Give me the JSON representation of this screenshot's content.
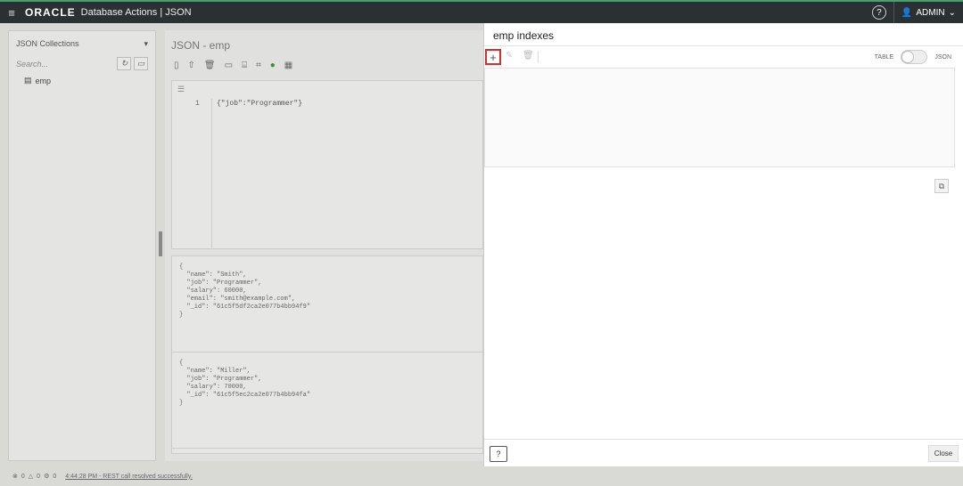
{
  "topbar": {
    "menu_icon": "hamburger-icon",
    "logo": "ORACLE",
    "app_title": "Database Actions | JSON",
    "help_icon": "?",
    "user_label": "ADMIN",
    "accent_color": "#3ea86b"
  },
  "left": {
    "header": "JSON Collections",
    "search_placeholder": "Search...",
    "items": [
      {
        "label": "emp"
      }
    ]
  },
  "center": {
    "title": "JSON - emp",
    "editor": {
      "line_number": "1",
      "code": "{\"job\":\"Programmer\"}"
    },
    "documents": [
      "{\n  \"name\": \"Smith\",\n  \"job\": \"Programmer\",\n  \"salary\": 60000,\n  \"email\": \"smith@example.com\",\n  \"_id\": \"61c5f5df2ca2e077b4bb94f9\"\n}",
      "{\n  \"name\": \"Miller\",\n  \"job\": \"Programmer\",\n  \"salary\": 70000,\n  \"_id\": \"61c5f5ec2ca2e077b4bb94fa\"\n}"
    ]
  },
  "drawer": {
    "title": "emp indexes",
    "add_label": "+",
    "toggle_left": "TABLE",
    "toggle_right": "JSON",
    "close_label": "Close",
    "highlight_color": "#d9302c"
  },
  "status": {
    "error_count": "0",
    "warning_count": "0",
    "task_count": "0",
    "message": "4:44:28 PM - REST call resolved successfully."
  }
}
